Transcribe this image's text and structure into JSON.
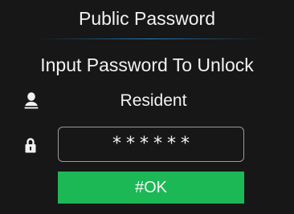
{
  "screen": {
    "title": "Public Password",
    "prompt": "Input Password To Unlock"
  },
  "user": {
    "icon": "user-icon",
    "name": "Resident"
  },
  "password": {
    "icon": "lock-icon",
    "masked_value": "******"
  },
  "actions": {
    "ok_label": "#OK"
  },
  "colors": {
    "background": "#171717",
    "ok_button": "#1cb856",
    "divider_accent": "#2a8cd2",
    "field_border": "#9a9a9a"
  }
}
